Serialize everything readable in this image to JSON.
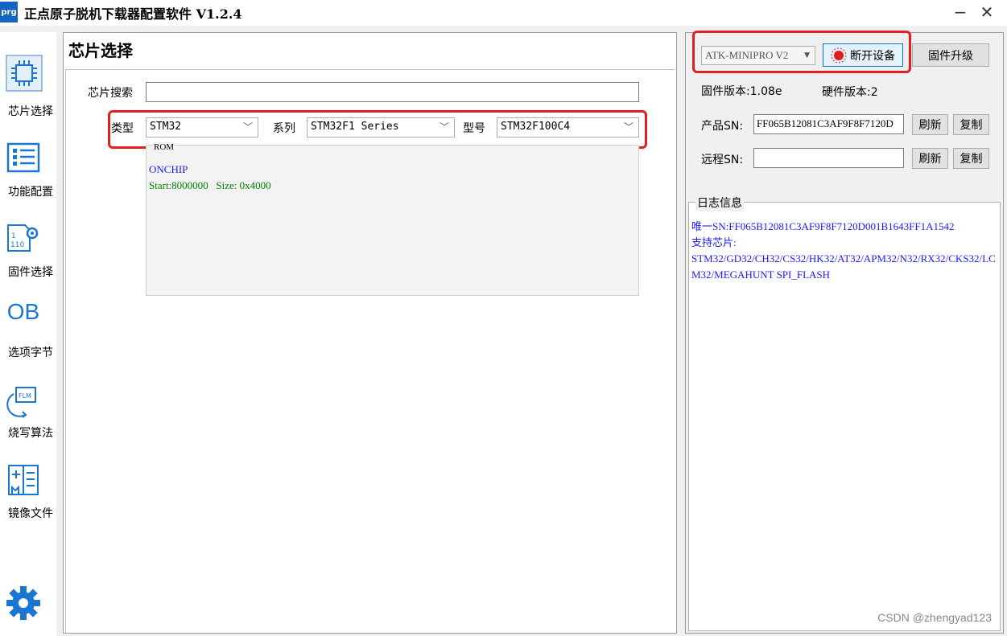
{
  "window": {
    "title": "正点原子脱机下载器配置软件 V1.2.4",
    "app_icon_text": "prg",
    "minimize": "−",
    "close": "✕"
  },
  "sidebar": {
    "items": [
      {
        "label": "芯片选择",
        "icon": "chip-icon"
      },
      {
        "label": "功能配置",
        "icon": "config-list-icon"
      },
      {
        "label": "固件选择",
        "icon": "firmware-icon"
      },
      {
        "label": "选项字节",
        "icon": "ob-icon",
        "icon_text": "OB"
      },
      {
        "label": "烧写算法",
        "icon": "flash-algorithm-icon"
      },
      {
        "label": "镜像文件",
        "icon": "image-file-icon"
      }
    ],
    "settings_icon": "gear-icon"
  },
  "chip_page": {
    "title": "芯片选择",
    "search_label": "芯片搜索",
    "search_value": "",
    "type_label": "类型",
    "type_value": "STM32",
    "series_label": "系列",
    "series_value": "STM32F1 Series",
    "model_label": "型号",
    "model_value": "STM32F100C4",
    "rom": {
      "legend": "ROM",
      "name": "ONCHIP",
      "detail": "Start:8000000   Size: 0x4000"
    }
  },
  "device": {
    "device_value": "ATK-MINIPRO V2",
    "disconnect_label": "断开设备",
    "firmware_upgrade_label": "固件升级",
    "firmware_version": "固件版本:1.08e",
    "hardware_version": "硬件版本:2",
    "product_sn_label": "产品SN:",
    "product_sn_value": "FF065B12081C3AF9F8F7120D",
    "remote_sn_label": "远程SN:",
    "remote_sn_value": "",
    "refresh_label": "刷新",
    "copy_label": "复制"
  },
  "log": {
    "legend": "日志信息",
    "lines": [
      "唯一SN:FF065B12081C3AF9F8F7120D001B1643FF1A1542",
      "支持芯片:",
      "STM32/GD32/CH32/CS32/HK32/AT32/APM32/N32/RX32/CKS32/LCM32/MEGAHUNT SPI_FLASH"
    ]
  },
  "watermark": "CSDN @zhengyad123",
  "colors": {
    "highlight": "#e02020",
    "accent": "#1976d2",
    "log_text": "#1a1aff",
    "rom_name": "#1a1aff",
    "rom_detail": "#008000"
  }
}
